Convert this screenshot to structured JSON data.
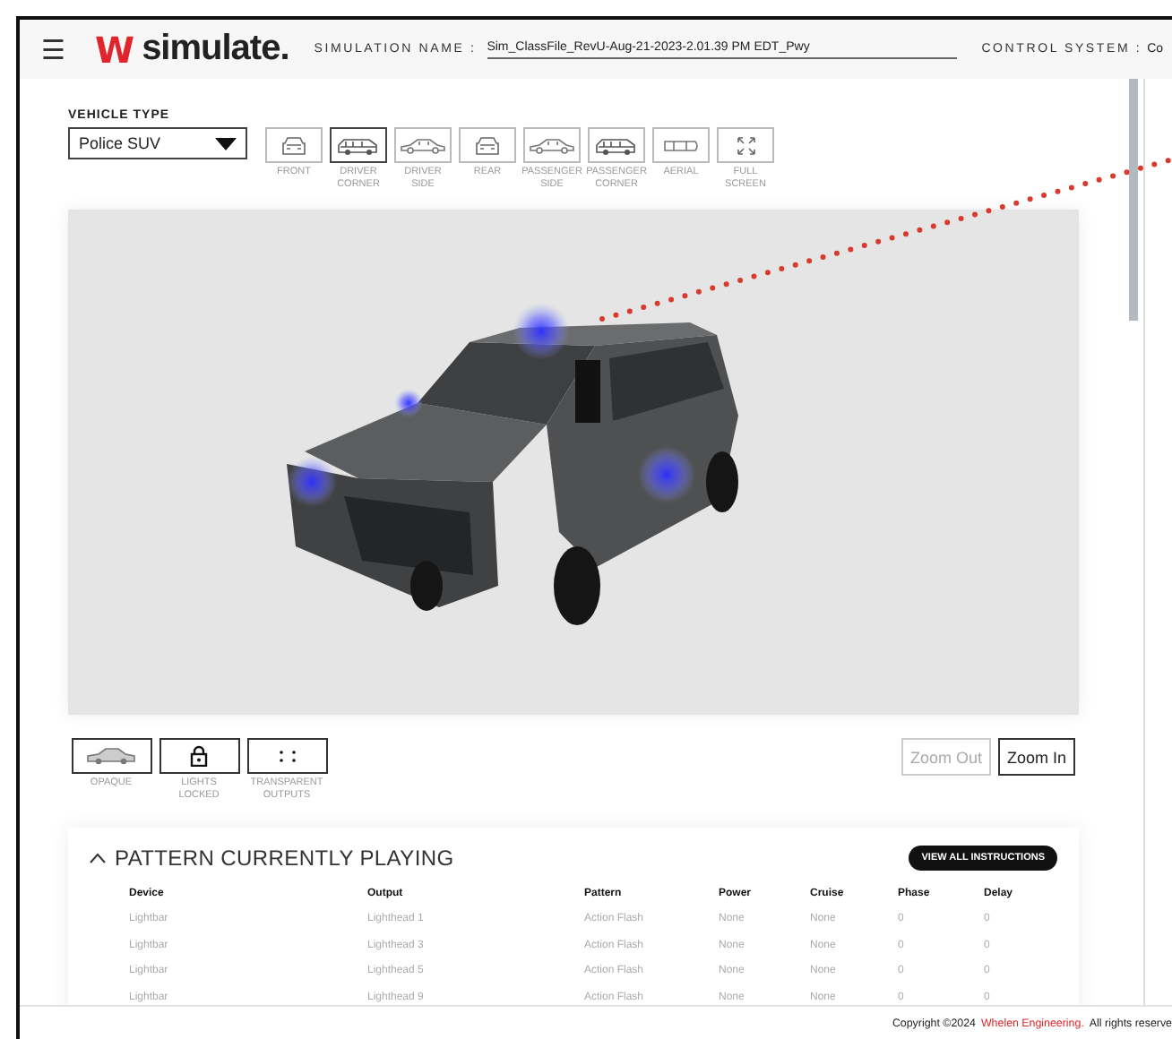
{
  "header": {
    "menu_icon": "☰",
    "logo_mark": "W",
    "logo_text": "simulate.",
    "simulation_name_label": "SIMULATION NAME :",
    "simulation_name": "Sim_ClassFile_RevU-Aug-21-2023-2.01.39 PM EDT_Pwy",
    "control_system_label": "CONTROL SYSTEM :",
    "control_system": "Co"
  },
  "vehicle_type": {
    "label": "VEHICLE TYPE",
    "value": "Police SUV"
  },
  "views": [
    {
      "label": "FRONT",
      "kind": "front",
      "selected": false
    },
    {
      "label": "DRIVER CORNER",
      "kind": "corner",
      "selected": true
    },
    {
      "label": "DRIVER SIDE",
      "kind": "side",
      "selected": false
    },
    {
      "label": "REAR",
      "kind": "front",
      "selected": false
    },
    {
      "label": "PASSENGER SIDE",
      "kind": "side",
      "selected": false
    },
    {
      "label": "PASSENGER CORNER",
      "kind": "corner",
      "selected": false
    },
    {
      "label": "AERIAL",
      "kind": "aerial",
      "selected": false
    },
    {
      "label": "FULL SCREEN",
      "kind": "fullscreen",
      "selected": false
    }
  ],
  "toggles": [
    {
      "label": "OPAQUE",
      "kind": "car"
    },
    {
      "label": "LIGHTS LOCKED",
      "kind": "lock"
    },
    {
      "label": "TRANSPARENT OUTPUTS",
      "kind": "dots"
    }
  ],
  "zoom_buttons": [
    {
      "label": "Zoom Out",
      "disabled": true
    },
    {
      "label": "Zoom In",
      "disabled": false
    }
  ],
  "pattern": {
    "title": "PATTERN CURRENTLY PLAYING",
    "expanded": true,
    "button": "VIEW ALL INSTRUCTIONS",
    "columns": [
      "Device",
      "Output",
      "Pattern",
      "Power",
      "Cruise",
      "Phase",
      "Delay"
    ],
    "rows": [
      [
        "Lightbar",
        "Lighthead 1",
        "Action Flash",
        "None",
        "None",
        "0",
        "0"
      ],
      [
        "Lightbar",
        "Lighthead 3",
        "Action Flash",
        "None",
        "None",
        "0",
        "0"
      ],
      [
        "Lightbar",
        "Lighthead 5",
        "Action Flash",
        "None",
        "None",
        "0",
        "0"
      ],
      [
        "Lightbar",
        "Lighthead 9",
        "Action Flash",
        "None",
        "None",
        "0",
        "0"
      ]
    ]
  },
  "footer": {
    "text": "Copyright ©2024",
    "link": "Whelen Engineering.",
    "rest": "All rights reserve"
  }
}
